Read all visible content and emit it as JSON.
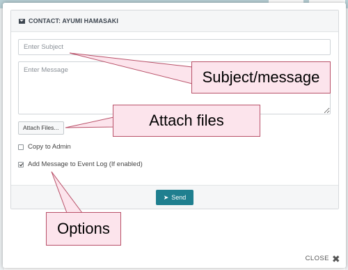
{
  "dialog": {
    "title": "CONTACT: AYUMI HAMASAKI",
    "subject_placeholder": "Enter Subject",
    "message_placeholder": "Enter Message",
    "attach_label": "Attach Files...",
    "options": [
      {
        "label": "Copy to Admin",
        "checked": false
      },
      {
        "label": "Add Message to Event Log (If enabled)",
        "checked": true
      }
    ],
    "send_label": "Send",
    "close_label": "CLOSE"
  },
  "callouts": {
    "subject_message": "Subject/message",
    "attach_files": "Attach files",
    "options": "Options"
  },
  "colors": {
    "send_button": "#1f7f8f",
    "callout_fill": "#fce4ec",
    "callout_border": "#b85068"
  }
}
